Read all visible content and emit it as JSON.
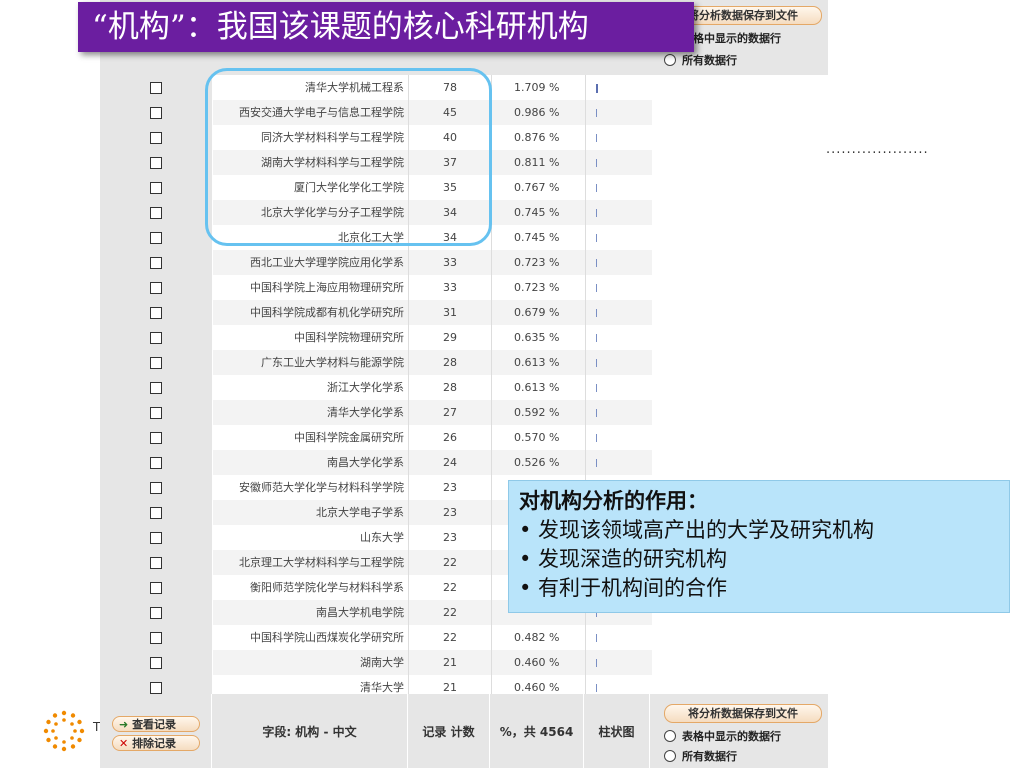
{
  "title": "“机构”：我国该课题的核心科研机构",
  "save_panel": {
    "save_label": "将分析数据保存到文件",
    "option_table_rows": "表格中显示的数据行",
    "option_all_rows": "所有数据行"
  },
  "rows": [
    {
      "name": "清华大学机械工程系",
      "count": "78",
      "pct": "1.709 %"
    },
    {
      "name": "西安交通大学电子与信息工程学院",
      "count": "45",
      "pct": "0.986 %"
    },
    {
      "name": "同济大学材料科学与工程学院",
      "count": "40",
      "pct": "0.876 %"
    },
    {
      "name": "湖南大学材料科学与工程学院",
      "count": "37",
      "pct": "0.811 %"
    },
    {
      "name": "厦门大学化学化工学院",
      "count": "35",
      "pct": "0.767 %"
    },
    {
      "name": "北京大学化学与分子工程学院",
      "count": "34",
      "pct": "0.745 %"
    },
    {
      "name": "北京化工大学",
      "count": "34",
      "pct": "0.745 %"
    },
    {
      "name": "西北工业大学理学院应用化学系",
      "count": "33",
      "pct": "0.723 %"
    },
    {
      "name": "中国科学院上海应用物理研究所",
      "count": "33",
      "pct": "0.723 %"
    },
    {
      "name": "中国科学院成都有机化学研究所",
      "count": "31",
      "pct": "0.679 %"
    },
    {
      "name": "中国科学院物理研究所",
      "count": "29",
      "pct": "0.635 %"
    },
    {
      "name": "广东工业大学材料与能源学院",
      "count": "28",
      "pct": "0.613 %"
    },
    {
      "name": "浙江大学化学系",
      "count": "28",
      "pct": "0.613 %"
    },
    {
      "name": "清华大学化学系",
      "count": "27",
      "pct": "0.592 %"
    },
    {
      "name": "中国科学院金属研究所",
      "count": "26",
      "pct": "0.570 %"
    },
    {
      "name": "南昌大学化学系",
      "count": "24",
      "pct": "0.526 %"
    },
    {
      "name": "安徽师范大学化学与材料科学学院",
      "count": "23",
      "pct": ""
    },
    {
      "name": "北京大学电子学系",
      "count": "23",
      "pct": ""
    },
    {
      "name": "山东大学",
      "count": "23",
      "pct": ""
    },
    {
      "name": "北京理工大学材料科学与工程学院",
      "count": "22",
      "pct": ""
    },
    {
      "name": "衡阳师范学院化学与材料科学系",
      "count": "22",
      "pct": ""
    },
    {
      "name": "南昌大学机电学院",
      "count": "22",
      "pct": ""
    },
    {
      "name": "中国科学院山西煤炭化学研究所",
      "count": "22",
      "pct": "0.482 %"
    },
    {
      "name": "湖南大学",
      "count": "21",
      "pct": "0.460 %"
    },
    {
      "name": "清华大学",
      "count": "21",
      "pct": "0.460 %"
    }
  ],
  "dots": "....................",
  "callout": {
    "title": "对机构分析的作用：",
    "points": [
      "• 发现该领域高产出的大学及研究机构",
      "• 发现深造的研究机构",
      "• 有利于机构间的合作"
    ]
  },
  "footer": {
    "view_records": "查看记录",
    "exclude_records": "排除记录",
    "field_label": "字段: 机构 - 中文",
    "record_count_label": "记录 计数",
    "pct_label": "%，共 4564",
    "bar_label": "柱状图",
    "logo_letter": "T"
  }
}
